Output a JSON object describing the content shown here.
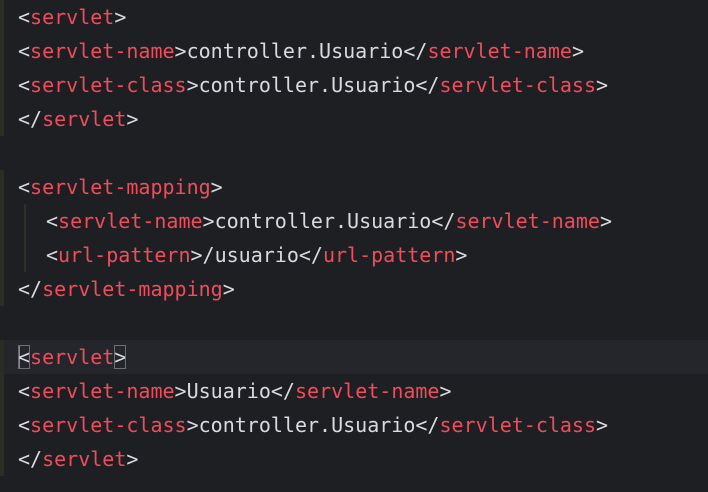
{
  "editor": {
    "language": "xml",
    "colors": {
      "background": "#1e1f22",
      "tag": "#f14c5c",
      "text": "#d7dae0",
      "cursor": "#4c8fff"
    },
    "lines": [
      {
        "tag": "servlet"
      },
      {
        "tag": "servlet-name",
        "text": "controller.Usuario"
      },
      {
        "tag": "servlet-class",
        "text": "controller.Usuario"
      },
      {
        "tag": "servlet"
      },
      {},
      {
        "tag": "servlet-mapping"
      },
      {
        "tag": "servlet-name",
        "text": "controller.Usuario"
      },
      {
        "tag": "url-pattern",
        "text": "/usuario"
      },
      {
        "tag": "servlet-mapping"
      },
      {},
      {
        "tag": "servlet"
      },
      {
        "tag": "servlet-name",
        "text": "Usuario"
      },
      {
        "tag": "servlet-class",
        "text": "controller.Usuario"
      },
      {
        "tag": "servlet"
      }
    ]
  }
}
